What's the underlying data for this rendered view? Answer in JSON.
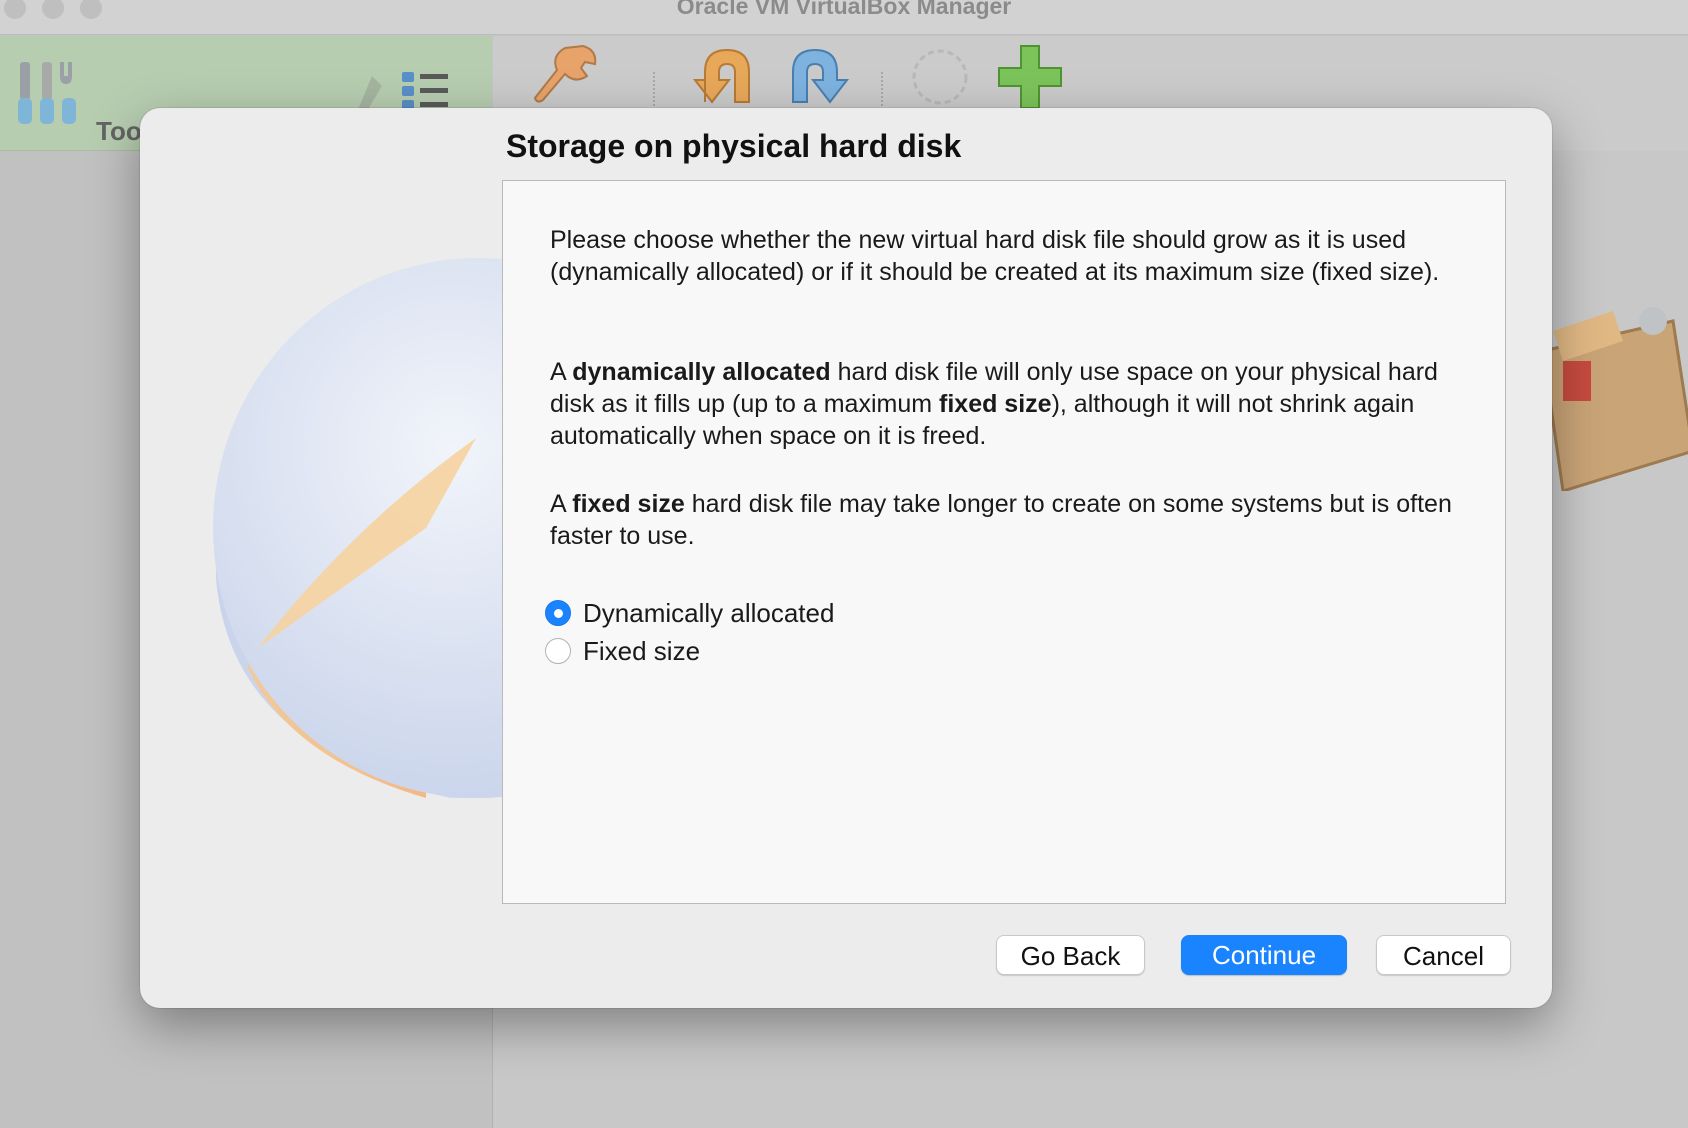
{
  "window": {
    "title": "Oracle VM VirtualBox Manager"
  },
  "sidebar": {
    "tools_label": "Tools"
  },
  "toolbar": {
    "items": [
      {
        "icon": "settings-wrench-icon"
      },
      {
        "icon": "discard-arrow-icon"
      },
      {
        "icon": "start-arrow-icon"
      },
      {
        "icon": "gear-placeholder-icon"
      },
      {
        "icon": "add-plus-icon"
      }
    ]
  },
  "dialog": {
    "title": "Storage on physical hard disk",
    "intro": "Please choose whether the new virtual hard disk file should grow as it is used (dynamically allocated) or if it should be created at its maximum size (fixed size).",
    "para2": {
      "p1": "A ",
      "b1": "dynamically allocated",
      "p2": " hard disk file will only use space on your physical hard disk as it fills up (up to a maximum ",
      "b2": "fixed size",
      "p3": "), although it will not shrink again automatically when space on it is freed."
    },
    "para3": {
      "p1": "A ",
      "b1": "fixed size",
      "p2": " hard disk file may take longer to create on some systems but is often faster to use."
    },
    "options": [
      {
        "label": "Dynamically allocated",
        "selected": true
      },
      {
        "label": "Fixed size",
        "selected": false
      }
    ],
    "buttons": {
      "back": "Go Back",
      "continue": "Continue",
      "cancel": "Cancel"
    },
    "accent_color": "#1a84ff"
  }
}
